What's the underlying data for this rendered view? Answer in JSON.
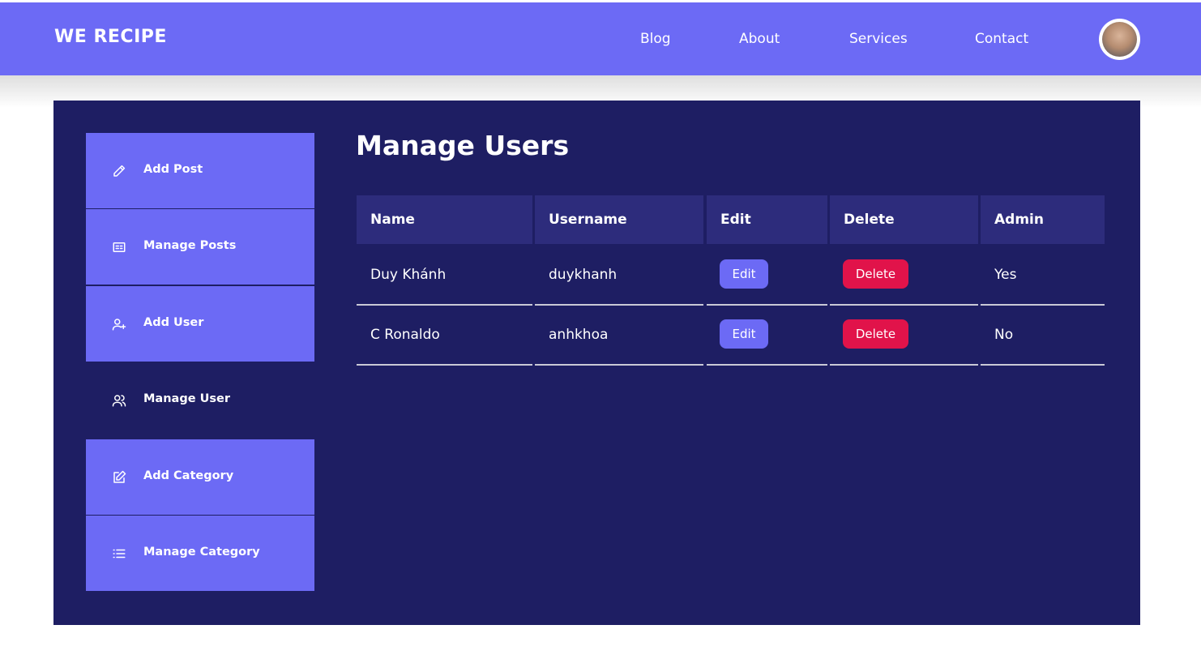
{
  "header": {
    "brand": "WE RECIPE",
    "nav": [
      "Blog",
      "About",
      "Services",
      "Contact"
    ]
  },
  "sidebar": {
    "items": [
      {
        "label": "Add Post",
        "icon": "pencil-icon"
      },
      {
        "label": "Manage Posts",
        "icon": "card-icon"
      },
      {
        "label": "Add User",
        "icon": "user-plus-icon"
      },
      {
        "label": "Manage User",
        "icon": "users-icon",
        "active": true
      },
      {
        "label": "Add Category",
        "icon": "edit-square-icon"
      },
      {
        "label": "Manage Category",
        "icon": "list-icon"
      }
    ]
  },
  "main": {
    "title": "Manage Users",
    "table": {
      "headers": [
        "Name",
        "Username",
        "Edit",
        "Delete",
        "Admin"
      ],
      "rows": [
        {
          "name": "Duy Khánh",
          "username": "duykhanh",
          "edit": "Edit",
          "delete": "Delete",
          "admin": "Yes"
        },
        {
          "name": "C Ronaldo",
          "username": "anhkhoa",
          "edit": "Edit",
          "delete": "Delete",
          "admin": "No"
        }
      ]
    }
  },
  "colors": {
    "accent": "#6c6af5",
    "panel": "#1e1e63",
    "header_cell": "#2d2c7c",
    "danger": "#e1134a"
  }
}
